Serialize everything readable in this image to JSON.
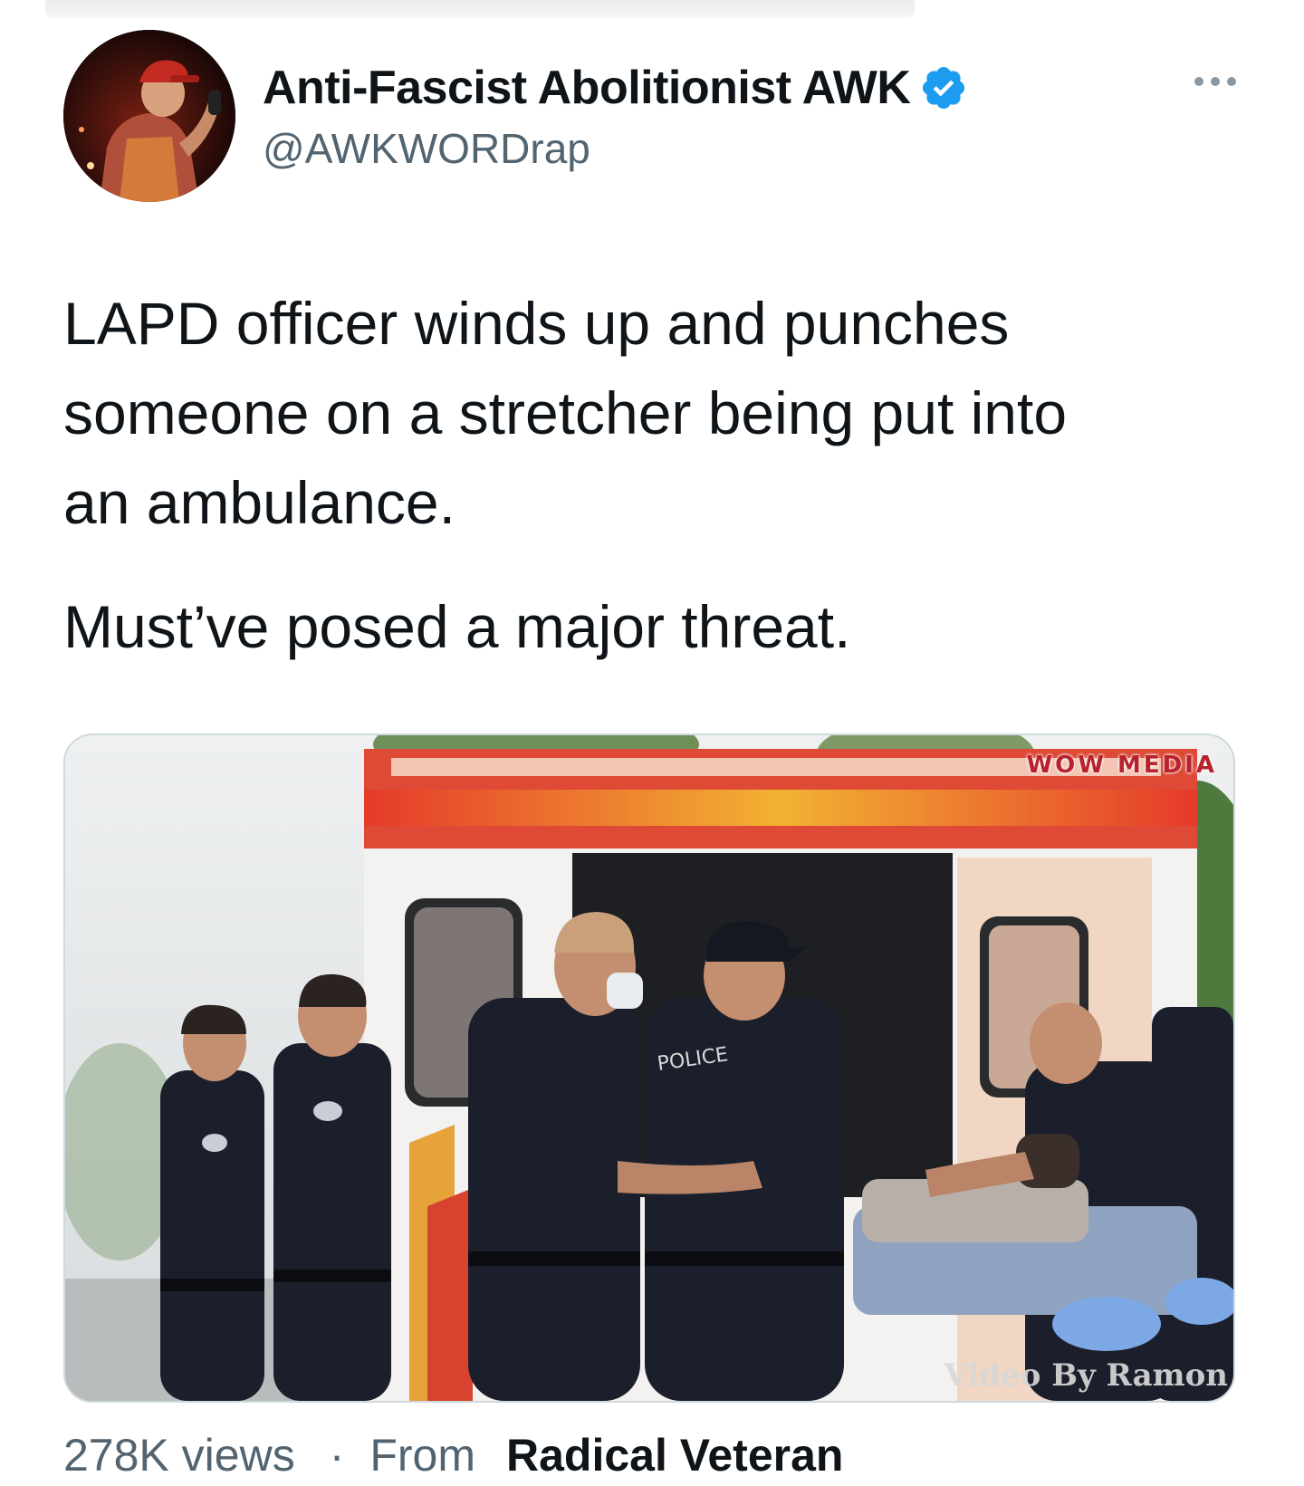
{
  "tweet": {
    "author": {
      "display_name": "Anti-Fascist Abolitionist AWK",
      "handle": "@AWKWORDrap",
      "verified": true,
      "verified_color": "#1d9bf0"
    },
    "menu_icon": "more-horizontal-icon",
    "text": [
      "LAPD officer winds up and punches someone on a stretcher being put into an ambulance.",
      "Must’ve posed a major threat."
    ],
    "text_lines": [
      "LAPD officer winds up and punches",
      "someone on a stretcher being put into",
      "an ambulance."
    ],
    "media": {
      "type": "video",
      "watermark_top": "WOW MEDIA",
      "watermark_bottom": "Video By Ramon"
    },
    "footer": {
      "views": "278K views",
      "separator": "·",
      "from_label": "From",
      "source": "Radical Veteran"
    }
  },
  "colors": {
    "text_primary": "#0f1419",
    "text_secondary": "#536471",
    "border": "#cfd9de"
  }
}
